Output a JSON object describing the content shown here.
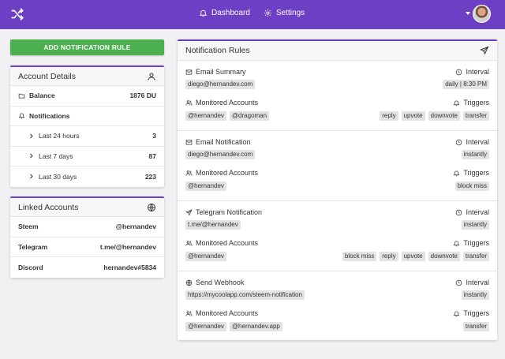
{
  "nav": {
    "dashboard": "Dashboard",
    "settings": "Settings"
  },
  "add_button": "ADD NOTIFICATION RULE",
  "account": {
    "title": "Account Details",
    "balance_label": "Balance",
    "balance_value": "1876 DU",
    "notifications_label": "Notifications",
    "periods": [
      {
        "label": "Last 24 hours",
        "value": "3"
      },
      {
        "label": "Last 7 days",
        "value": "87"
      },
      {
        "label": "Last 30 days",
        "value": "223"
      }
    ]
  },
  "linked": {
    "title": "Linked Accounts",
    "items": [
      {
        "label": "Steem",
        "value": "@hernandev"
      },
      {
        "label": "Telegram",
        "value": "t.me/@hernandev"
      },
      {
        "label": "Discord",
        "value": "hernandev#5834"
      }
    ]
  },
  "rules_title": "Notification Rules",
  "rules": [
    {
      "type": "Email Summary",
      "target": "diego@hernandev.com",
      "interval_label": "Interval",
      "interval": "daily | 8:30 PM",
      "monitored_label": "Monitored Accounts",
      "accounts": [
        "@hernandev",
        "@dragoman"
      ],
      "triggers_label": "Triggers",
      "triggers": [
        "reply",
        "upvote",
        "downvote",
        "transfer"
      ]
    },
    {
      "type": "Email Notification",
      "target": "diego@hernandev.com",
      "interval_label": "Interval",
      "interval": "instantly",
      "monitored_label": "Monitored Accounts",
      "accounts": [
        "@hernandev"
      ],
      "triggers_label": "Triggers",
      "triggers": [
        "block miss"
      ]
    },
    {
      "type": "Telegram Notification",
      "target": "t.me/@hernandev",
      "interval_label": "Interval",
      "interval": "instantly",
      "monitored_label": "Monitored Accounts",
      "accounts": [
        "@hernandev"
      ],
      "triggers_label": "Triggers",
      "triggers": [
        "block miss",
        "reply",
        "upvote",
        "downvote",
        "transfer"
      ]
    },
    {
      "type": "Send Webhook",
      "target": "https://mycoolapp.com/steem-notification",
      "interval_label": "Interval",
      "interval": "instantly",
      "monitored_label": "Monitored Accounts",
      "accounts": [
        "@hernandev",
        "@hernandev.app"
      ],
      "triggers_label": "Triggers",
      "triggers": [
        "transfer"
      ]
    }
  ],
  "icons": {
    "logo": "shuffle-icon",
    "dashboard": "bell-icon",
    "settings": "gear-icon",
    "rule_types": [
      "mail-icon",
      "mail-icon",
      "send-icon",
      "globe-icon"
    ]
  },
  "colors": {
    "primary": "#6c3fc4",
    "add_button": "#4caf50"
  }
}
